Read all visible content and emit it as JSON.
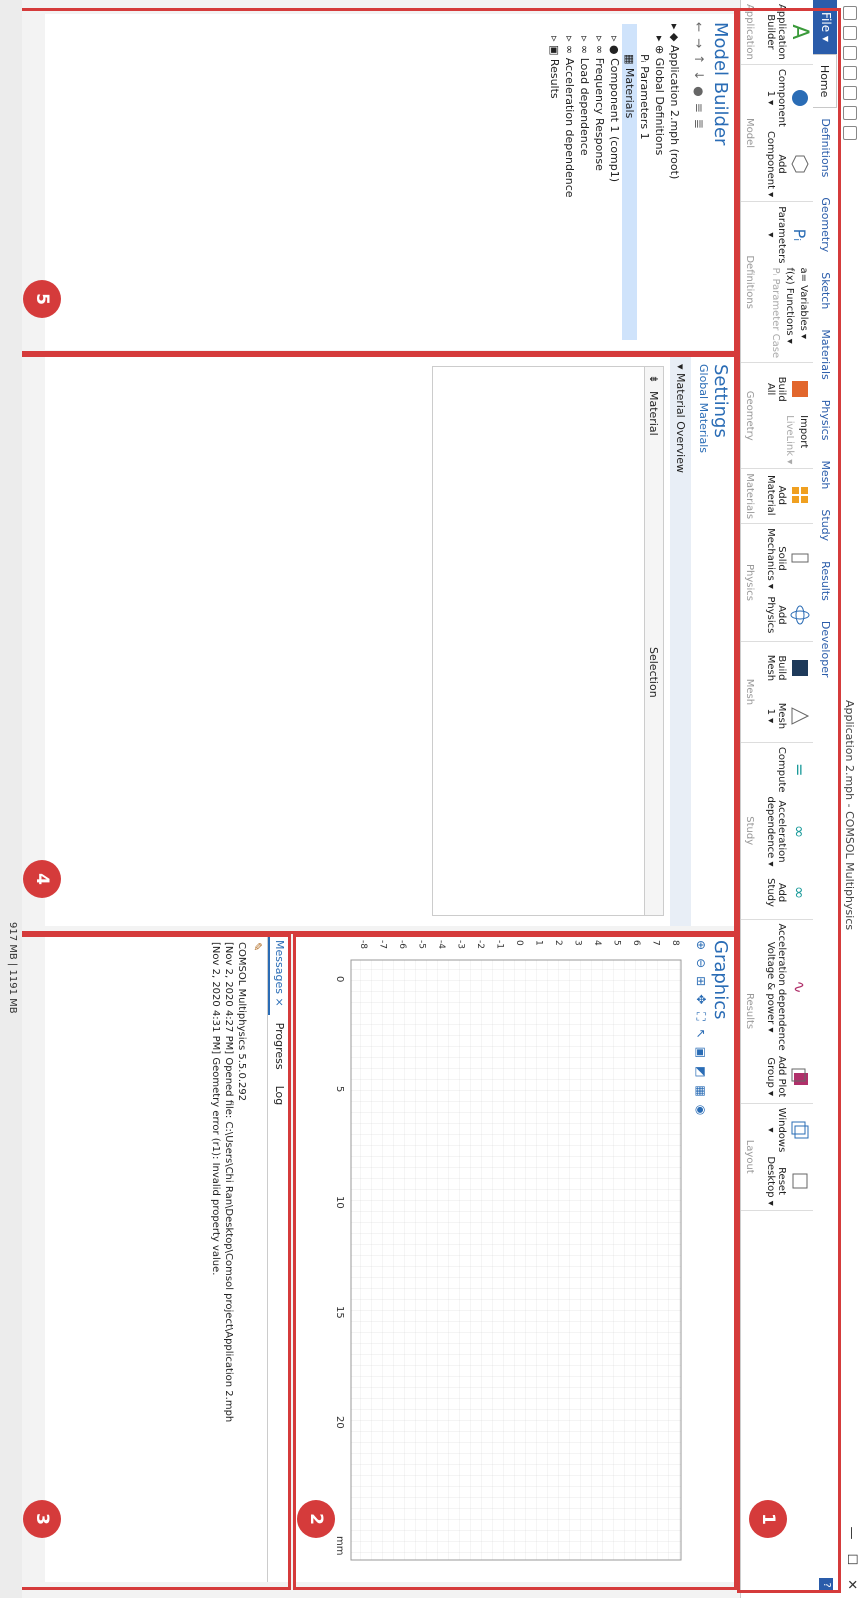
{
  "app": {
    "title": "Application 2.mph - COMSOL Multiphysics",
    "help": "?"
  },
  "tabs": {
    "file": "File ▾",
    "items": [
      "Home",
      "Definitions",
      "Geometry",
      "Sketch",
      "Materials",
      "Physics",
      "Mesh",
      "Study",
      "Results",
      "Developer"
    ]
  },
  "ribbon": {
    "application": {
      "group": "Application",
      "builder_l1": "Application",
      "builder_l2": "Builder"
    },
    "model": {
      "group": "Model",
      "component_l1": "Component",
      "component_l2": "1 ▾",
      "add_component_l1": "Add",
      "add_component_l2": "Component ▾"
    },
    "definitions": {
      "group": "Definitions",
      "parameters_l1": "Parameters",
      "parameters_l2": "▾",
      "variables": "a= Variables ▾",
      "functions": "f(x) Functions ▾",
      "parameter_case": "Pᵢ Parameter Case"
    },
    "geometry": {
      "group": "Geometry",
      "build_l1": "Build",
      "build_l2": "All",
      "import": "Import",
      "livelink": "LiveLink ▾"
    },
    "materials": {
      "group": "Materials",
      "add_l1": "Add",
      "add_l2": "Material"
    },
    "physics": {
      "group": "Physics",
      "solid_l1": "Solid",
      "solid_l2": "Mechanics ▾",
      "add_l1": "Add",
      "add_l2": "Physics"
    },
    "mesh": {
      "group": "Mesh",
      "build_l1": "Build",
      "build_l2": "Mesh",
      "mesh_l1": "Mesh",
      "mesh_l2": "1 ▾"
    },
    "study": {
      "group": "Study",
      "compute": "Compute",
      "accel_l1": "Acceleration",
      "accel_l2": "dependence ▾",
      "add_l1": "Add",
      "add_l2": "Study"
    },
    "results": {
      "group": "Results",
      "plot_l1": "Acceleration dependence",
      "plot_l2": "Voltage & power ▾",
      "add_l1": "Add Plot",
      "add_l2": "Group ▾"
    },
    "layout": {
      "group": "Layout",
      "windows_l1": "Windows",
      "windows_l2": "▾",
      "reset_l1": "Reset",
      "reset_l2": "Desktop ▾"
    }
  },
  "model_builder": {
    "title": "Model Builder",
    "tree": [
      "Application 2.mph (root)",
      "Global Definitions",
      "Parameters 1",
      "Materials",
      "Component 1 (comp1)",
      "Frequency Response",
      "Load dependence",
      "Acceleration dependence",
      "Results"
    ]
  },
  "settings": {
    "title": "Settings",
    "subtitle": "Global Materials",
    "section": "Material Overview",
    "col_material": "Material",
    "col_selection": "Selection"
  },
  "graphics": {
    "title": "Graphics",
    "unit": "mm",
    "x_ticks": [
      "0",
      "5",
      "10",
      "15",
      "20"
    ],
    "y_ticks": [
      "8",
      "7",
      "6",
      "5",
      "4",
      "3",
      "2",
      "1",
      "0",
      "-1",
      "-2",
      "-3",
      "-4",
      "-5",
      "-6",
      "-7",
      "-8"
    ]
  },
  "messages": {
    "tabs": [
      "Messages ×",
      "Progress",
      "Log"
    ],
    "lines": [
      "COMSOL Multiphysics 5.5.0.292",
      "[Nov 2, 2020 4:27 PM] Opened file: C:\\Users\\Chi Ran\\Desktop\\Comsol project\\Application 2.mph",
      "[Nov 2, 2020 4:31 PM] Geometry error (r1): Invalid property value."
    ]
  },
  "status": {
    "memory": "917 MB | 1191 MB"
  },
  "badges": [
    "1",
    "2",
    "3",
    "4",
    "5"
  ],
  "colors": {
    "accent": "#2a5caa",
    "annotation": "#d53b3b",
    "selected": "#cfe3fb"
  }
}
